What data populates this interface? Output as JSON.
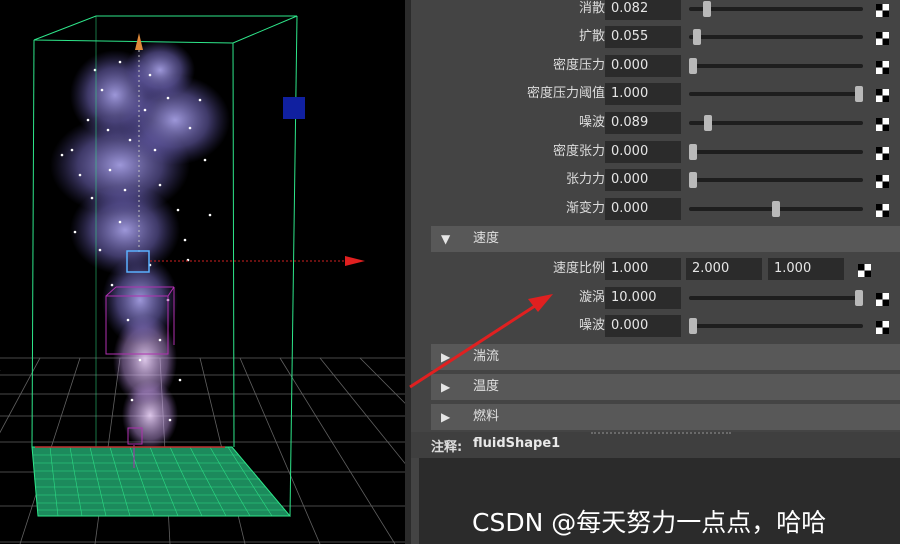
{
  "sliders": [
    {
      "label": "消散",
      "value": "0.082",
      "level": 0.02
    },
    {
      "label": "扩散",
      "value": "0.055",
      "level": 0.01
    },
    {
      "label": "密度压力",
      "value": "0.000",
      "level": 0.0
    },
    {
      "label": "密度压力阈值",
      "value": "1.000",
      "level": 1.0
    },
    {
      "label": "噪波",
      "value": "0.089",
      "level": 0.09
    },
    {
      "label": "密度张力",
      "value": "0.000",
      "level": 0.0
    },
    {
      "label": "张力力",
      "value": "0.000",
      "level": 0.0
    },
    {
      "label": "渐变力",
      "value": "0.000",
      "level": 0.5
    }
  ],
  "velocity_section": {
    "title": "速度",
    "scale_label": "速度比例",
    "scale_values": [
      "1.000",
      "2.000",
      "1.000"
    ],
    "swirl": {
      "label": "漩涡",
      "value": "10.000",
      "level": 1.0
    },
    "noise": {
      "label": "噪波",
      "value": "0.000",
      "level": 0.0
    }
  },
  "collapsed_sections": [
    "湍流",
    "温度",
    "燃料"
  ],
  "notes": {
    "label": "注释:",
    "value": "fluidShape1"
  },
  "watermark": "CSDN @每天努力一点点，哈哈",
  "colors": {
    "annotation_arrow": "#e02020",
    "fluid_box": "#2ee68a",
    "smoke": "#8a7fd6",
    "panel_bg": "#444444"
  }
}
